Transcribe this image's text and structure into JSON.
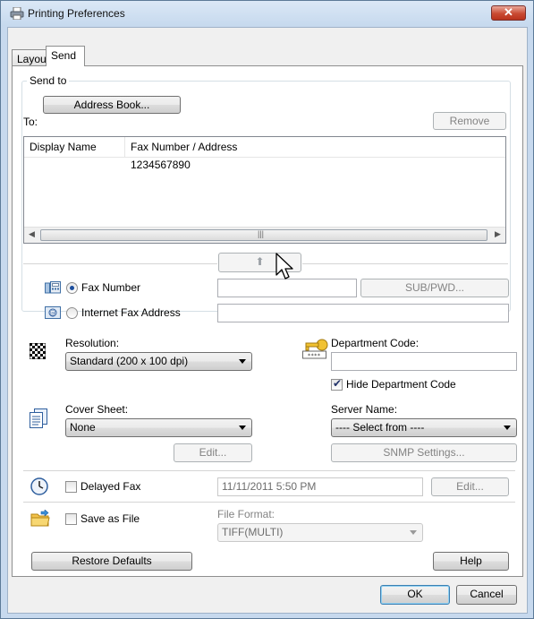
{
  "window": {
    "title": "Printing Preferences",
    "close_glyph": "✕"
  },
  "tabs": [
    {
      "label": "Layout"
    },
    {
      "label": "Send"
    }
  ],
  "send_to": {
    "legend": "Send to",
    "address_book_label": "Address Book...",
    "to_label": "To:",
    "remove_label": "Remove",
    "columns": [
      "Display Name",
      "Fax Number / Address"
    ],
    "rows": [
      {
        "display_name": "",
        "address": "1234567890"
      }
    ],
    "add_arrow": "⬆",
    "fax_number_label": "Fax Number",
    "fax_number_value": "",
    "sub_pwd_label": "SUB/PWD...",
    "internet_fax_label": "Internet Fax Address",
    "internet_fax_value": ""
  },
  "resolution": {
    "label": "Resolution:",
    "selected": "Standard (200 x 100 dpi)"
  },
  "department": {
    "label": "Department Code:",
    "value": "",
    "hide_label": "Hide Department Code",
    "hide_checked": true
  },
  "cover_sheet": {
    "label": "Cover Sheet:",
    "selected": "None",
    "edit_label": "Edit..."
  },
  "server": {
    "label": "Server Name:",
    "selected": "---- Select from ----",
    "snmp_label": "SNMP Settings..."
  },
  "delayed_fax": {
    "label": "Delayed Fax",
    "value": "11/11/2011 5:50 PM",
    "edit_label": "Edit..."
  },
  "save_file": {
    "label": "Save as File",
    "format_label": "File Format:",
    "format_selected": "TIFF(MULTI)"
  },
  "footer": {
    "restore_label": "Restore Defaults",
    "help_label": "Help",
    "ok_label": "OK",
    "cancel_label": "Cancel"
  }
}
